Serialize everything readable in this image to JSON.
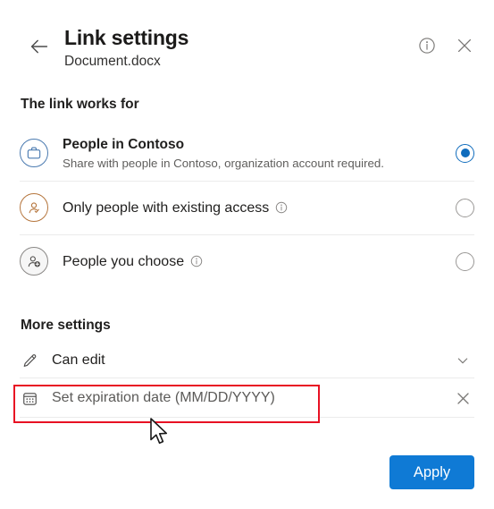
{
  "header": {
    "title": "Link settings",
    "subtitle": "Document.docx",
    "back_icon": "back-arrow-icon",
    "info_icon": "info-icon",
    "close_icon": "close-icon"
  },
  "link_works_for": {
    "heading": "The link works for",
    "options": [
      {
        "icon": "briefcase-icon",
        "title": "People in Contoso",
        "subtitle": "Share with people in Contoso, organization account required.",
        "has_info": false,
        "selected": true
      },
      {
        "icon": "person-check-icon",
        "title": "Only people with existing access",
        "subtitle": "",
        "has_info": true,
        "selected": false
      },
      {
        "icon": "person-add-icon",
        "title": "People you choose",
        "subtitle": "",
        "has_info": true,
        "selected": false
      }
    ]
  },
  "more_settings": {
    "heading": "More settings",
    "permission": {
      "icon": "pencil-icon",
      "label": "Can edit",
      "trailing_icon": "chevron-down-icon"
    },
    "expiration": {
      "icon": "calendar-icon",
      "placeholder": "Set expiration date (MM/DD/YYYY)",
      "value": "",
      "trailing_icon": "close-icon"
    }
  },
  "footer": {
    "apply_label": "Apply"
  },
  "annotation": {
    "highlight_color": "#e81123",
    "cursor": "mouse-pointer"
  },
  "colors": {
    "accent_blue": "#0f6cbd",
    "apply_blue": "#0f7ad5",
    "icon_blue": "#4a7ab0",
    "icon_amber": "#b5753c",
    "icon_gray": "#8a8886",
    "divider": "#ebebeb"
  }
}
